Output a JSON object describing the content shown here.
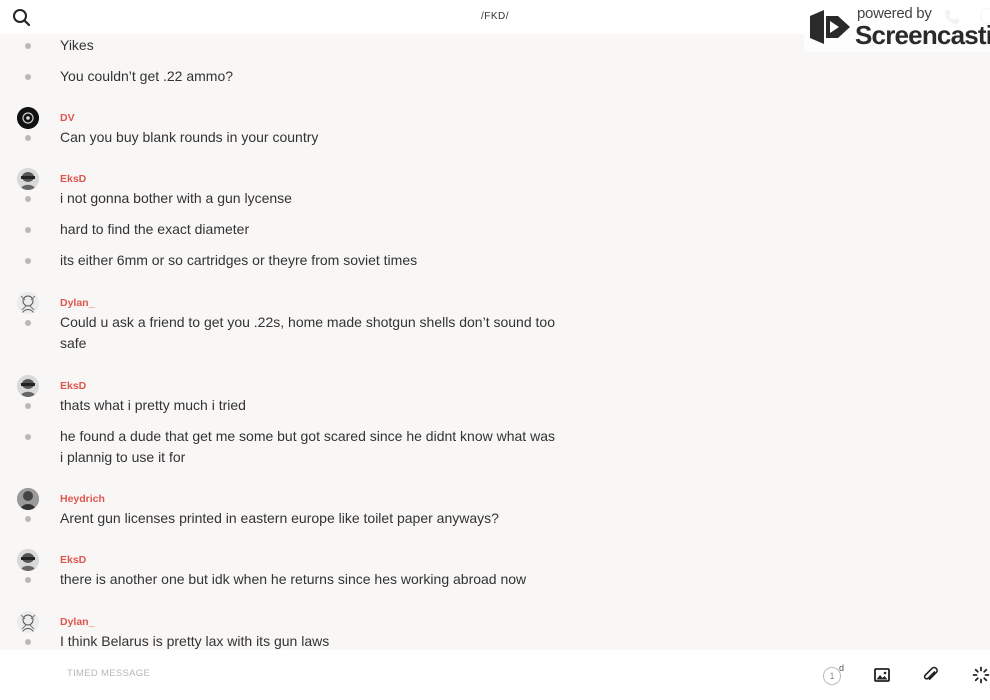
{
  "header": {
    "search_icon": "search-icon",
    "channel_title": "/FKD/"
  },
  "watermark": {
    "small_text": "powered by",
    "brand_text": "Screencastify"
  },
  "messages": [
    {
      "author": null,
      "avatar": null,
      "lines": [
        "Yikes"
      ]
    },
    {
      "author": null,
      "avatar": null,
      "lines": [
        "You couldn’t get .22 ammo?"
      ]
    },
    {
      "author": "DV",
      "avatar": "avatar-dark",
      "lines": [
        "Can you buy blank rounds in your country"
      ]
    },
    {
      "author": "EksD",
      "avatar": "avatar-face",
      "lines": [
        "i not gonna bother with a gun lycense",
        "hard to find the exact diameter",
        "its either 6mm or so cartridges or theyre from soviet times"
      ]
    },
    {
      "author": "Dylan_",
      "avatar": "avatar-sketch",
      "lines": [
        "Could u ask a friend to get you .22s, home made shotgun shells don’t sound too safe"
      ]
    },
    {
      "author": "EksD",
      "avatar": "avatar-face",
      "lines": [
        "thats what i pretty much i tried",
        "he found a dude that get me some but got scared since he didnt know what was i plannig to use it for"
      ]
    },
    {
      "author": "Heydrich",
      "avatar": "avatar-gray",
      "lines": [
        "Arent gun licenses printed in eastern europe like toilet paper anyways?"
      ]
    },
    {
      "author": "EksD",
      "avatar": "avatar-face",
      "lines": [
        "there is another one but idk when he returns since hes working abroad now"
      ]
    },
    {
      "author": "Dylan_",
      "avatar": "avatar-sketch",
      "lines": [
        "I think Belarus is pretty lax with its gun laws"
      ]
    }
  ],
  "composer": {
    "placeholder": "TIMED MESSAGE",
    "timer_value": "1",
    "timer_unit": "d",
    "icons": [
      "image-icon",
      "attachment-icon",
      "loading-icon"
    ]
  }
}
